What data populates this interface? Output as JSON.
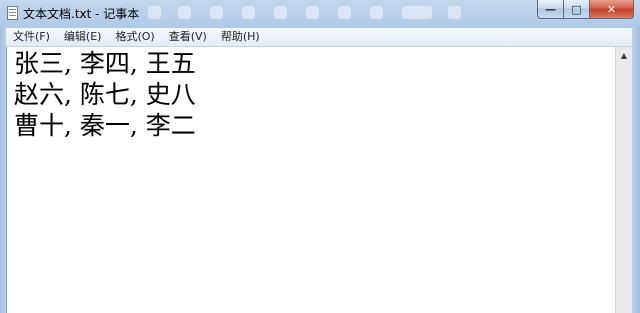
{
  "window": {
    "title": "文本文档.txt - 记事本",
    "icon": "notepad-icon",
    "controls": {
      "minimize": "—",
      "maximize": "□",
      "close": "✕"
    }
  },
  "menu": {
    "items": [
      "文件(F)",
      "编辑(E)",
      "格式(O)",
      "查看(V)",
      "帮助(H)"
    ]
  },
  "editor": {
    "lines": [
      "张三, 李四, 王五",
      "赵六, 陈七, 史八",
      "曹十, 秦一, 李二"
    ]
  },
  "scrollbar": {
    "up_arrow": "▲"
  },
  "colors": {
    "frame": "#b9d1ea",
    "close": "#c2402a",
    "editor_bg": "#ffffff"
  }
}
